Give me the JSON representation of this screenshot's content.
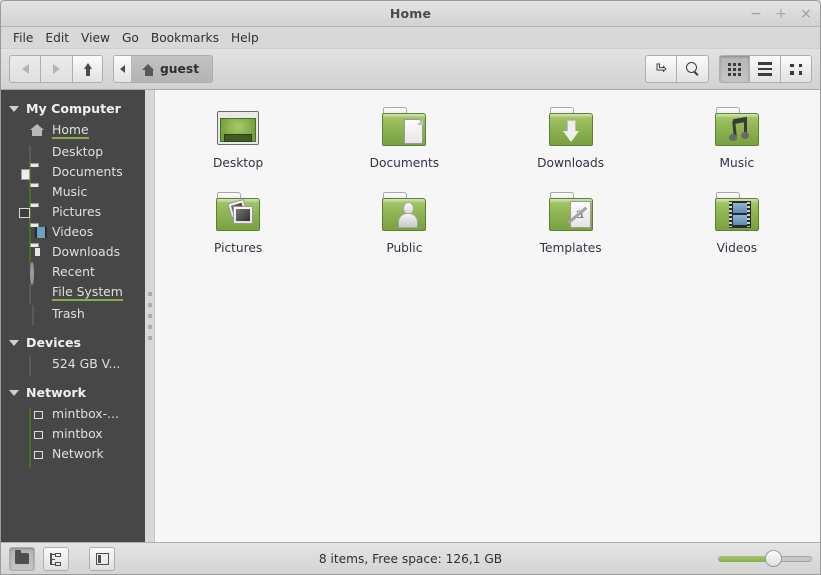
{
  "window": {
    "title": "Home",
    "controls": {
      "minimize": "−",
      "maximize": "+",
      "close": "×"
    }
  },
  "menubar": {
    "items": [
      {
        "label": "File"
      },
      {
        "label": "Edit"
      },
      {
        "label": "View"
      },
      {
        "label": "Go"
      },
      {
        "label": "Bookmarks"
      },
      {
        "label": "Help"
      }
    ]
  },
  "toolbar": {
    "back": {
      "name": "back-button",
      "enabled": false
    },
    "forward": {
      "name": "forward-button",
      "enabled": false
    },
    "up": {
      "name": "up-button",
      "enabled": true
    },
    "breadcrumb": {
      "previous_label": "‹",
      "current": "guest"
    },
    "path_entry_label": "⏎",
    "search_label": "",
    "view_modes": [
      {
        "name": "icon-view",
        "active": true
      },
      {
        "name": "list-view",
        "active": false
      },
      {
        "name": "compact-view",
        "active": false
      }
    ]
  },
  "sidebar": {
    "sections": [
      {
        "label": "My Computer",
        "expanded": true,
        "items": [
          {
            "label": "Home",
            "icon": "home-icon",
            "underlined": true
          },
          {
            "label": "Desktop",
            "icon": "desktop-icon",
            "underlined": false
          },
          {
            "label": "Documents",
            "icon": "documents-folder-icon",
            "underlined": false
          },
          {
            "label": "Music",
            "icon": "music-folder-icon",
            "underlined": false
          },
          {
            "label": "Pictures",
            "icon": "pictures-folder-icon",
            "underlined": false
          },
          {
            "label": "Videos",
            "icon": "videos-folder-icon",
            "underlined": false
          },
          {
            "label": "Downloads",
            "icon": "downloads-folder-icon",
            "underlined": false
          },
          {
            "label": "Recent",
            "icon": "recent-icon",
            "underlined": false
          },
          {
            "label": "File System",
            "icon": "disk-icon",
            "underlined": true
          },
          {
            "label": "Trash",
            "icon": "trash-icon",
            "underlined": false
          }
        ]
      },
      {
        "label": "Devices",
        "expanded": true,
        "items": [
          {
            "label": "524 GB V...",
            "icon": "disk-icon",
            "underlined": false
          }
        ]
      },
      {
        "label": "Network",
        "expanded": true,
        "items": [
          {
            "label": "mintbox-...",
            "icon": "network-folder-icon",
            "underlined": false
          },
          {
            "label": "mintbox",
            "icon": "network-folder-icon",
            "underlined": false
          },
          {
            "label": "Network",
            "icon": "network-folder-icon",
            "underlined": false
          }
        ]
      }
    ]
  },
  "content": {
    "files": [
      {
        "label": "Desktop",
        "icon": "desktop-folder-icon"
      },
      {
        "label": "Documents",
        "icon": "documents-folder-icon"
      },
      {
        "label": "Downloads",
        "icon": "downloads-folder-icon"
      },
      {
        "label": "Music",
        "icon": "music-folder-icon"
      },
      {
        "label": "Pictures",
        "icon": "pictures-folder-icon"
      },
      {
        "label": "Public",
        "icon": "public-folder-icon"
      },
      {
        "label": "Templates",
        "icon": "templates-folder-icon"
      },
      {
        "label": "Videos",
        "icon": "videos-folder-icon"
      }
    ]
  },
  "statusbar": {
    "buttons": [
      {
        "name": "places-view-button",
        "active": true
      },
      {
        "name": "tree-view-button",
        "active": false
      },
      {
        "name": "toggle-sidebar-button",
        "active": false
      }
    ],
    "text": "8 items, Free space: 126,1 GB",
    "zoom_percent": 53
  },
  "colors": {
    "accent_green": "#8aab4f",
    "folder_green": "#8fb553",
    "sidebar_bg": "#474747",
    "content_bg": "#f6f6f6",
    "chrome_bg": "#dcdcdc"
  }
}
